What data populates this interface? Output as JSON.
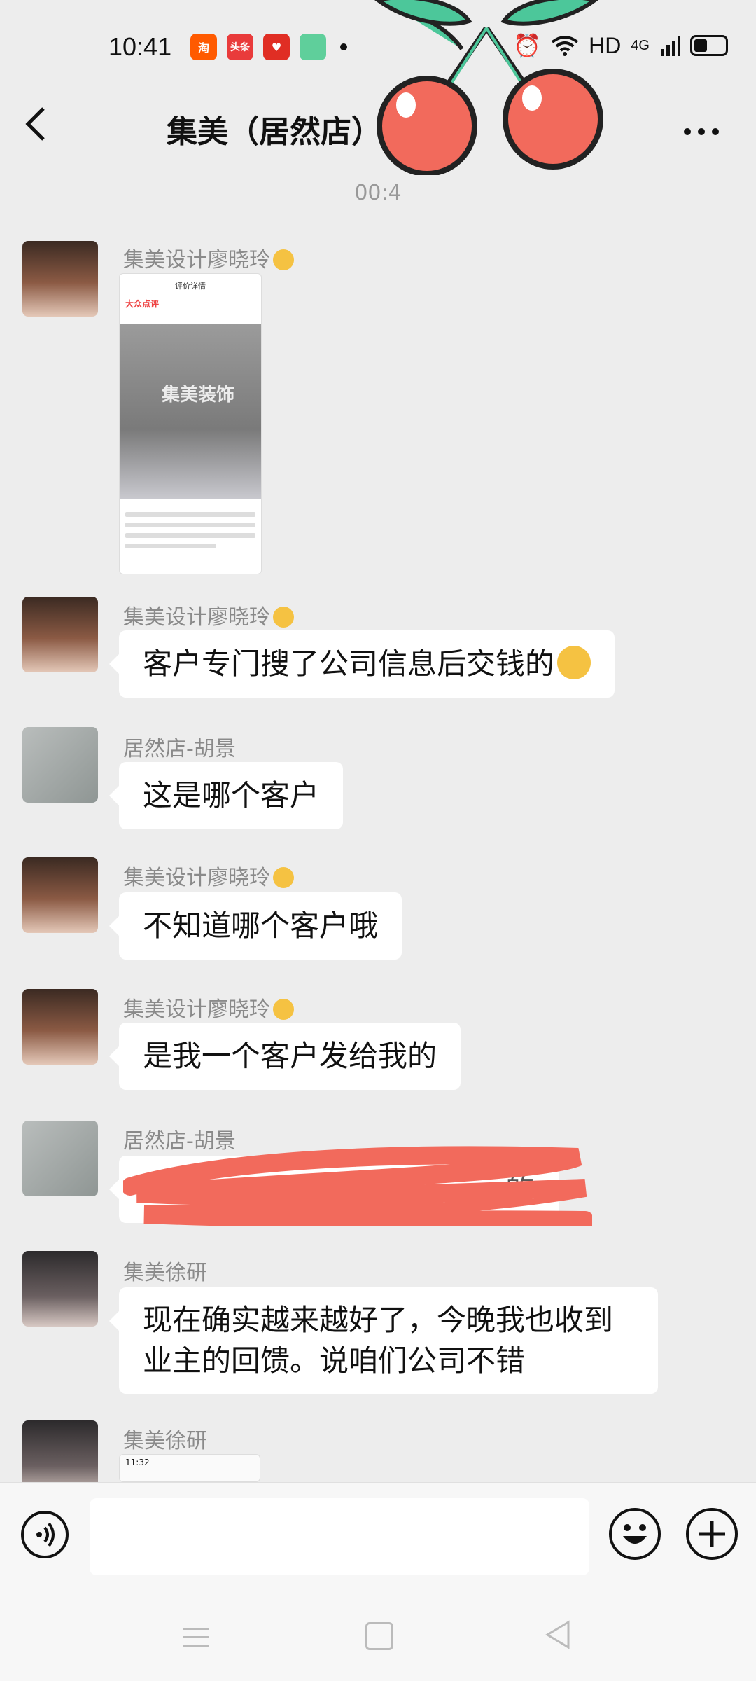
{
  "status_bar": {
    "time": "10:41",
    "app_icons": [
      {
        "icon": "taobao-icon",
        "label": "淘",
        "color": "#ff5a00"
      },
      {
        "icon": "toutiao-icon",
        "label": "头条",
        "color": "#e93b3b"
      },
      {
        "icon": "pinduoduo-icon",
        "label": "",
        "color": "#e02e24"
      },
      {
        "icon": "app-icon",
        "label": "",
        "color": "#5fcf9b"
      }
    ],
    "network": "HD",
    "signal": "4G"
  },
  "nav": {
    "title": "集美（居然店）",
    "back_icon": "chevron-left-icon",
    "more_icon": "more-horizontal-icon"
  },
  "timestamp": "00:4",
  "messages": [
    {
      "sender": "集美设计廖晓玲",
      "type": "image",
      "image_caption": {
        "header": "评价详情",
        "logo": "大众点评",
        "sign": "集美装饰"
      }
    },
    {
      "sender": "集美设计廖晓玲",
      "type": "text",
      "text": "客户专门搜了公司信息后交钱的"
    },
    {
      "sender": "居然店-胡景",
      "type": "text",
      "text": "这是哪个客户"
    },
    {
      "sender": "集美设计廖晓玲",
      "type": "text",
      "text": "不知道哪个客户哦"
    },
    {
      "sender": "集美设计廖晓玲",
      "type": "text",
      "text": "是我一个客户发给我的"
    },
    {
      "sender": "居然店-胡景",
      "type": "redacted",
      "text": "…的"
    },
    {
      "sender": "集美徐研",
      "type": "text",
      "text": "现在确实越来越好了，今晚我也收到业主的回馈。说咱们公司不错"
    },
    {
      "sender": "集美徐研",
      "type": "image",
      "image_caption": {
        "header": "11:32"
      }
    }
  ],
  "input": {
    "placeholder": "",
    "voice_icon": "voice-icon",
    "emoji_icon": "emoji-icon",
    "plus_icon": "plus-icon"
  },
  "system_nav": {
    "menu_icon": "menu-icon",
    "home_icon": "home-icon",
    "back_icon": "triangle-back-icon"
  },
  "colors": {
    "background": "#ededed",
    "bubble": "#ffffff",
    "scribble": "#f26a5c",
    "sticker_cherry": "#f26a5c",
    "sticker_leaf": "#4cc79a"
  }
}
